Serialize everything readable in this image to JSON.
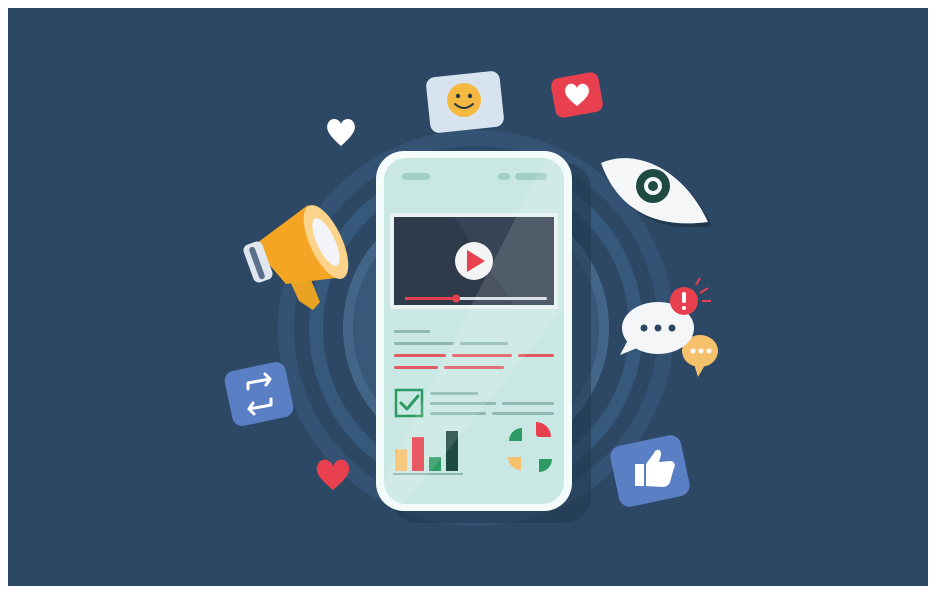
{
  "scene": {
    "background_color": "#2c4864",
    "accent_red": "#e8404f",
    "accent_orange": "#f5a524",
    "accent_green": "#1f8a5a",
    "accent_blue": "#5b7fc4",
    "phone_body": "#dfeef0",
    "phone_screen": "#c9e7e3"
  },
  "icons": [
    "megaphone-icon",
    "smiley-icon",
    "heart-icon",
    "eye-icon",
    "chat-bubble-icon",
    "alert-icon",
    "repost-icon",
    "thumbs-up-icon",
    "play-icon",
    "checkbox-icon",
    "bar-chart-icon",
    "pie-chart-icon"
  ],
  "video": {
    "progress": 0.36
  },
  "chart_data": {
    "type": "bar",
    "categories": [],
    "series": [
      {
        "values": [
          28,
          44,
          18,
          52
        ],
        "colors": [
          "#f5c26b",
          "#e8404f",
          "#2e9a63",
          "#1e4a40"
        ]
      }
    ]
  }
}
